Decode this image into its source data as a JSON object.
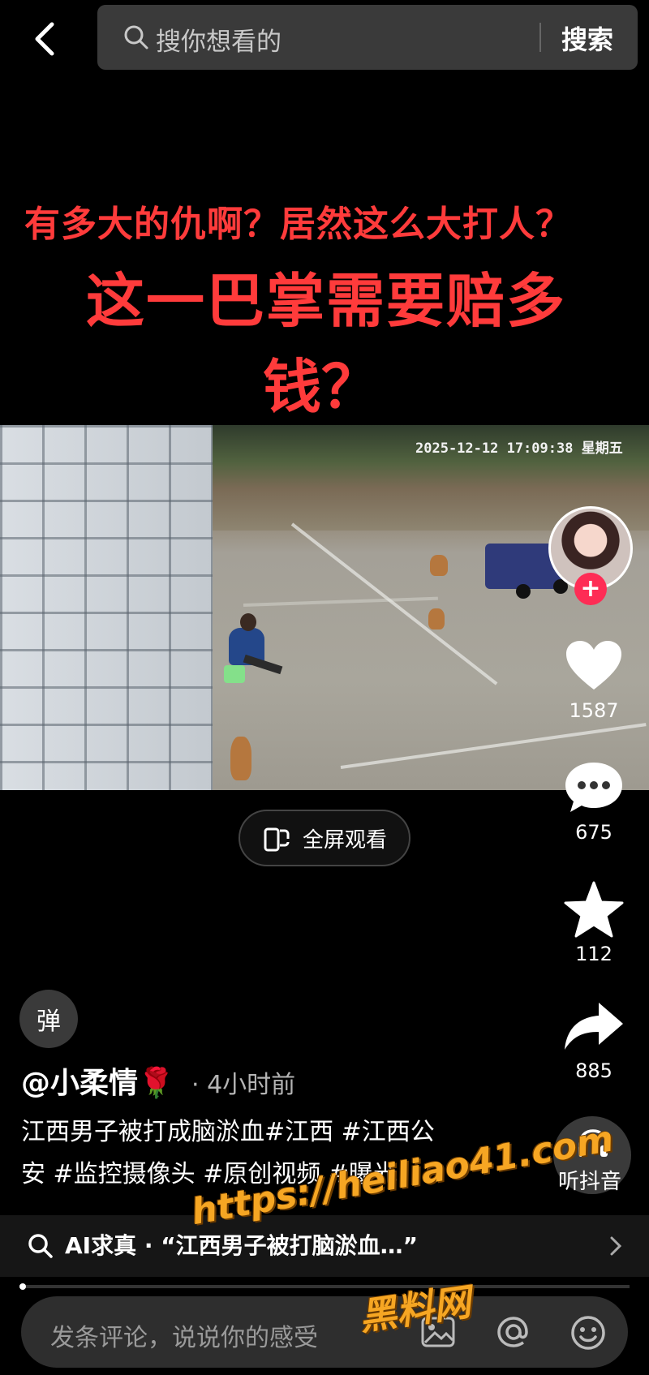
{
  "search": {
    "placeholder": "搜你想看的",
    "button_label": "搜索"
  },
  "overlay": {
    "line1": "有多大的仇啊？居然这么大打人？",
    "line2": "这一巴掌需要赔多",
    "line3": "钱？"
  },
  "video": {
    "timestamp": "2025-12-12  17:09:38  星期五",
    "fullscreen_label": "全屏观看"
  },
  "rail": {
    "likes": "1587",
    "comments": "675",
    "favorites": "112",
    "shares": "885",
    "listen_label": "听抖音"
  },
  "post": {
    "danmu_label": "弹",
    "author": "@小柔情🌹",
    "time": "· 4小时前",
    "desc_line1": "江西男子被打成脑淤血#江西 #江西公",
    "desc_line2": "安 #监控摄像头 #原创视频 #曝光"
  },
  "ai_bar": {
    "text": "AI求真 · “江西男子被打脑淤血…”"
  },
  "playback": {
    "progress": 0.01
  },
  "comment": {
    "placeholder": "发条评论，说说你的感受"
  },
  "watermark": {
    "line1": "https://heiliao41.com",
    "line2": "黑料网"
  },
  "colors": {
    "overlay_red": "#ff3b3b",
    "follow_pink": "#fe2c55",
    "watermark_orange": "#f6a623"
  }
}
